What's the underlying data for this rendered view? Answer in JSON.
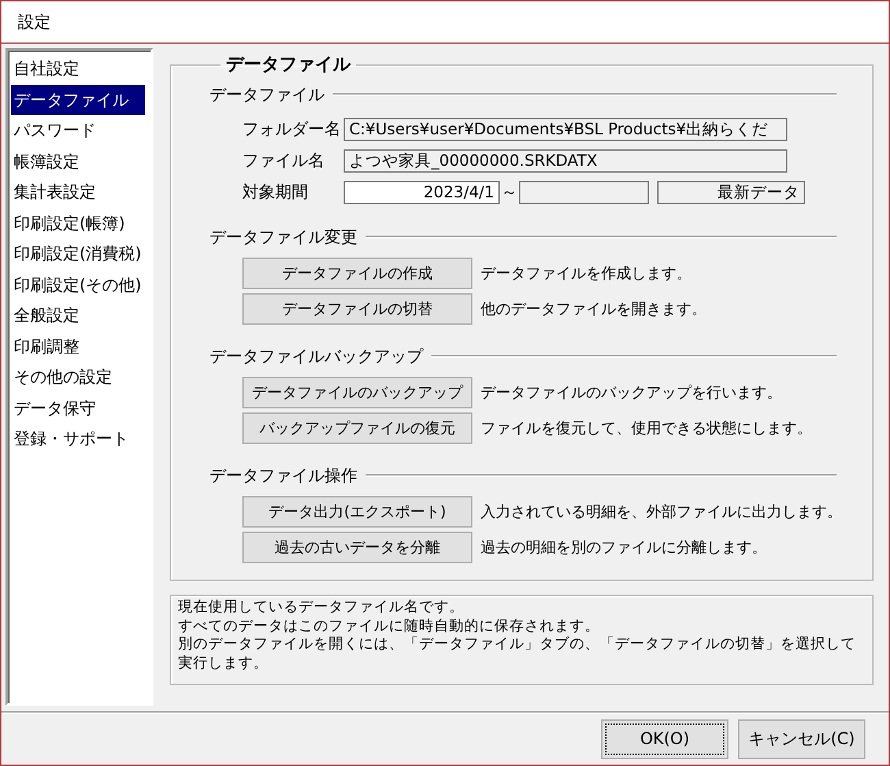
{
  "window": {
    "title": "設定"
  },
  "sidebar": {
    "items": [
      {
        "label": "自社設定",
        "selected": false
      },
      {
        "label": "データファイル",
        "selected": true
      },
      {
        "label": "パスワード",
        "selected": false
      },
      {
        "label": "帳簿設定",
        "selected": false
      },
      {
        "label": "集計表設定",
        "selected": false
      },
      {
        "label": "印刷設定(帳簿)",
        "selected": false
      },
      {
        "label": "印刷設定(消費税)",
        "selected": false
      },
      {
        "label": "印刷設定(その他)",
        "selected": false
      },
      {
        "label": "全般設定",
        "selected": false
      },
      {
        "label": "印刷調整",
        "selected": false
      },
      {
        "label": "その他の設定",
        "selected": false
      },
      {
        "label": "データ保守",
        "selected": false
      },
      {
        "label": "登録・サポート",
        "selected": false
      }
    ]
  },
  "panel": {
    "title": "データファイル",
    "sections": [
      {
        "kind": "fields",
        "title": "データファイル",
        "rows": [
          {
            "label": "フォルダー名",
            "fields": [
              {
                "value": "C:¥Users¥user¥Documents¥BSL Products¥出納らくだ",
                "white": false
              }
            ]
          },
          {
            "label": "ファイル名",
            "fields": [
              {
                "value": "よつや家具_00000000.SRKDATX",
                "white": false
              }
            ]
          },
          {
            "label": "対象期間",
            "fields": [
              {
                "value": "2023/4/1",
                "white": true
              },
              {
                "white": false
              },
              {
                "value": "最新データ",
                "white": false
              }
            ],
            "separator": "～"
          }
        ]
      },
      {
        "kind": "actions",
        "title": "データファイル変更",
        "actions": [
          {
            "button": "データファイルの作成",
            "description": "データファイルを作成します。"
          },
          {
            "button": "データファイルの切替",
            "description": "他のデータファイルを開きます。"
          }
        ]
      },
      {
        "kind": "actions",
        "title": "データファイルバックアップ",
        "actions": [
          {
            "button": "データファイルのバックアップ",
            "description": "データファイルのバックアップを行います。"
          },
          {
            "button": "バックアップファイルの復元",
            "description": "ファイルを復元して、使用できる状態にします。"
          }
        ]
      },
      {
        "kind": "actions",
        "title": "データファイル操作",
        "actions": [
          {
            "button": "データ出力(エクスポート)",
            "description": "入力されている明細を、外部ファイルに出力します。"
          },
          {
            "button": "過去の古いデータを分離",
            "description": "過去の明細を別のファイルに分離します。"
          }
        ]
      }
    ]
  },
  "help": {
    "lines": [
      "現在使用しているデータファイル名です。",
      "すべてのデータはこのファイルに随時自動的に保存されます。",
      "別のデータファイルを開くには、「データファイル」タブの、「データファイルの切替」を選択して実行します。"
    ]
  },
  "buttons": [
    {
      "label": "OK(O)",
      "focused": true
    },
    {
      "label": "キャンセル(C)",
      "focused": false
    }
  ]
}
